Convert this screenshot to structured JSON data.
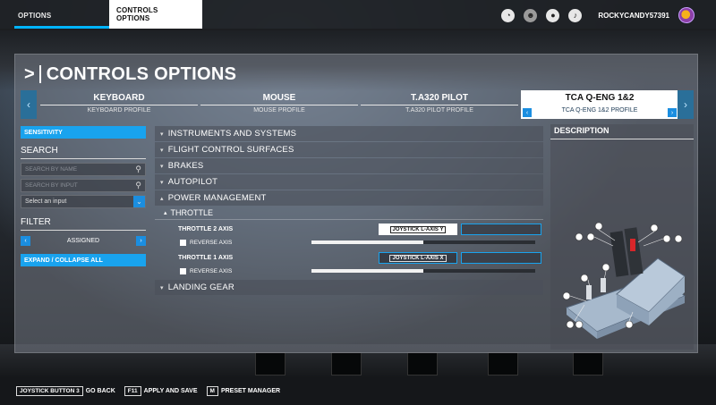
{
  "topbar": {
    "tab_options": "OPTIONS",
    "tab_controls": "CONTROLS OPTIONS",
    "username": "ROCKYCANDY57391",
    "icons": [
      "activity-icon",
      "friends-icon",
      "profile-icon",
      "notifications-icon"
    ]
  },
  "page": {
    "title": "CONTROLS OPTIONS"
  },
  "devices": [
    {
      "name": "KEYBOARD",
      "profile": "KEYBOARD PROFILE"
    },
    {
      "name": "MOUSE",
      "profile": "MOUSE PROFILE"
    },
    {
      "name": "T.A320 PILOT",
      "profile": "T.A320 PILOT PROFILE"
    },
    {
      "name": "TCA Q-ENG 1&2",
      "profile": "TCA Q-ENG 1&2 PROFILE",
      "active": true
    }
  ],
  "left": {
    "sensitivity": "SENSITIVITY",
    "search_label": "SEARCH",
    "search_by_name": "SEARCH BY NAME",
    "search_by_input": "SEARCH BY INPUT",
    "select_input": "Select an input",
    "filter_label": "FILTER",
    "filter_value": "ASSIGNED",
    "expand_collapse": "EXPAND / COLLAPSE ALL"
  },
  "categories": {
    "instruments": "INSTRUMENTS AND SYSTEMS",
    "flight_surfaces": "FLIGHT CONTROL SURFACES",
    "brakes": "BRAKES",
    "autopilot": "AUTOPILOT",
    "power": "POWER MANAGEMENT",
    "throttle": "THROTTLE",
    "landing_gear": "LANDING GEAR"
  },
  "bindings": {
    "throttle2": {
      "label": "THROTTLE 2 AXIS",
      "key": "JOYSTICK L-AXIS Y",
      "reverse": "REVERSE AXIS",
      "level": 0.5
    },
    "throttle1": {
      "label": "THROTTLE 1 AXIS",
      "key": "JOYSTICK L-AXIS X",
      "reverse": "REVERSE AXIS",
      "level": 0.5
    }
  },
  "description": {
    "header": "DESCRIPTION"
  },
  "bottom": {
    "back_key": "JOYSTICK BUTTON 3",
    "back": "GO BACK",
    "apply_key": "F11",
    "apply": "APPLY AND SAVE",
    "preset_key": "M",
    "preset": "PRESET MANAGER"
  },
  "colors": {
    "accent": "#19a3ee",
    "avatar_ring": "#8d3fa8"
  }
}
